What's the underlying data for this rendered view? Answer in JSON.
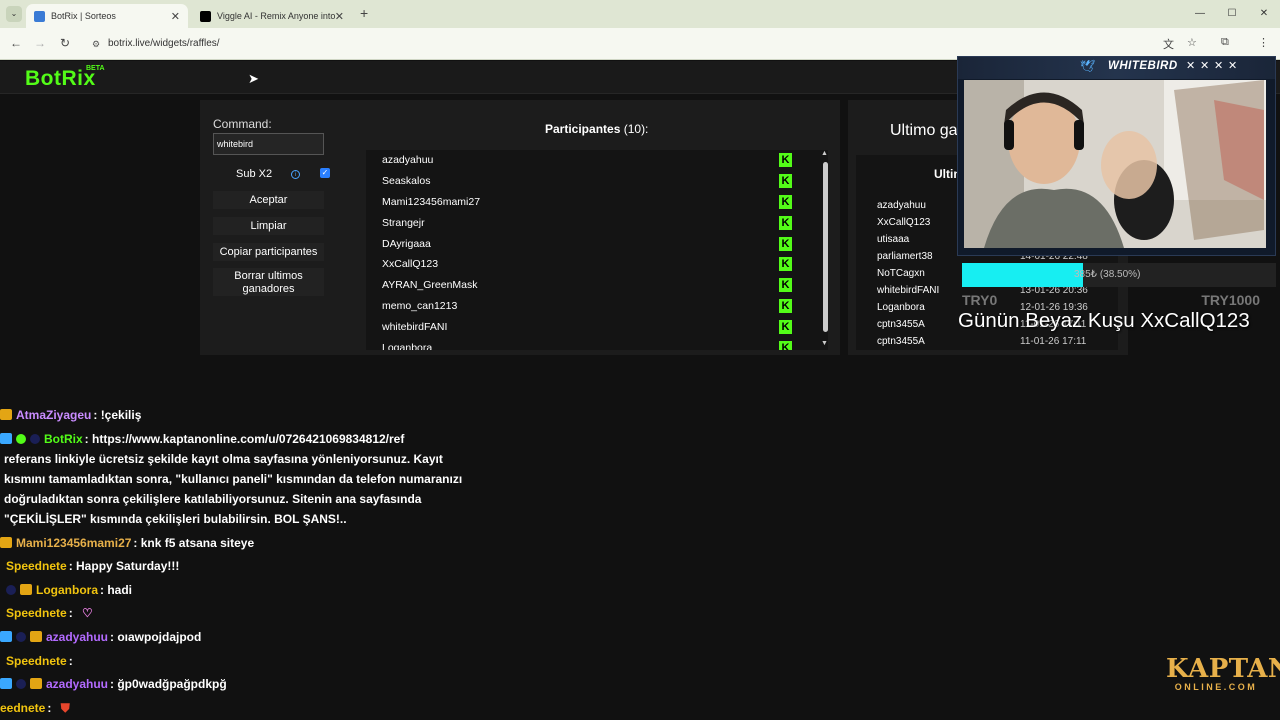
{
  "browser": {
    "tabs": [
      {
        "title": "BotRix | Sorteos",
        "active": true,
        "favicon_color": "#3a7bd5"
      },
      {
        "title": "Viggle AI - Remix Anyone into",
        "active": false,
        "favicon_color": "#000000"
      }
    ],
    "url": "botrix.live/widgets/raffles/"
  },
  "site": {
    "logo": "BotRix",
    "logo_badge": "BETA",
    "brand_color": "#53fc18"
  },
  "raffle": {
    "command_label": "Command:",
    "command_value": "whitebird",
    "sub_label": "Sub X2",
    "sub_checked": true,
    "buttons": {
      "accept": "Aceptar",
      "clear": "Limpiar",
      "copy": "Copiar participantes",
      "delete_line1": "Borrar ultimos",
      "delete_line2": "ganadores"
    },
    "participants_title": "Participantes",
    "participants_count": "(10):",
    "participants": [
      "azadyahuu",
      "Seaskalos",
      "Mami123456mami27",
      "Strangejr",
      "DAyrigaaa",
      "XxCallQ123",
      "AYRAN_GreenMask",
      "memo_can1213",
      "whitebirdFANI",
      "Loganbora"
    ],
    "kick_icon": "K"
  },
  "winners_panel": {
    "title": "Ultimo ga",
    "header": "Ultim",
    "rows": [
      {
        "name": "azadyahuu",
        "date": ""
      },
      {
        "name": "XxCallQ123",
        "date": ""
      },
      {
        "name": "utisaaa",
        "date": ""
      },
      {
        "name": "parliamert38",
        "date": "14-01-26 22:48"
      },
      {
        "name": "NoTCagxn",
        "date": ""
      },
      {
        "name": "whitebirdFANI",
        "date": "13-01-26 20:36"
      },
      {
        "name": "Loganbora",
        "date": "12-01-26 19:36"
      },
      {
        "name": "cptn3455A",
        "date": "11-01-26 17:11"
      },
      {
        "name": "cptn3455A",
        "date": "11-01-26 17:11"
      }
    ]
  },
  "stream_overlay": {
    "cam_name": "WHITEBIRD",
    "goal_percent_text": "385₺ (38.50%)",
    "goal_fraction": 0.385,
    "goal_color": "#17eef2",
    "try_min": "TRY0",
    "try_max": "TRY1000",
    "banner": "Günün Beyaz Kuşu XxCallQ123",
    "sponsor_main": "KAPTAN",
    "sponsor_sub": "ONLINE.COM"
  },
  "chat": {
    "messages": [
      {
        "user": "AtmaZiyageu",
        "color": "#c98cff",
        "text": ": !çekiliş"
      },
      {
        "user": "BotRix",
        "color": "#53fc18",
        "text": ": https://www.kaptanonline.com/u/0726421069834812/ref"
      },
      {
        "user": "Mami123456mami27",
        "color": "#e7b04a",
        "text": ": knk f5 atsana siteye"
      },
      {
        "user": "Speednete",
        "color": "#f1c40f",
        "text": ": Happy Saturday!!!"
      },
      {
        "user": "Loganbora",
        "color": "#f1c40f",
        "text": ": hadi"
      },
      {
        "user": "Speednete",
        "color": "#f1c40f",
        "text": ":"
      },
      {
        "user": "azadyahuu",
        "color": "#b36bff",
        "text": ": oıawpojdajpod"
      },
      {
        "user": "Speednete",
        "color": "#f1c40f",
        "text": ":"
      },
      {
        "user": "azadyahuu",
        "color": "#b36bff",
        "text": ": ğp0wadğpağpdkpğ"
      },
      {
        "user": "eednete",
        "color": "#f1c40f",
        "text": ":"
      }
    ],
    "bot_lines": [
      "referans linkiyle ücretsiz şekilde kayıt olma sayfasına yönleniyorsunuz. Kayıt",
      "kısmını tamamladıktan sonra, \"kullanıcı paneli\" kısmından da telefon numaranızı",
      "doğruladıktan sonra çekilişlere katılabiliyorsunuz. Sitenin ana sayfasında",
      "\"ÇEKİLİŞLER\" kısmında çekilişleri bulabilirsin. BOL ŞANS!.."
    ]
  }
}
